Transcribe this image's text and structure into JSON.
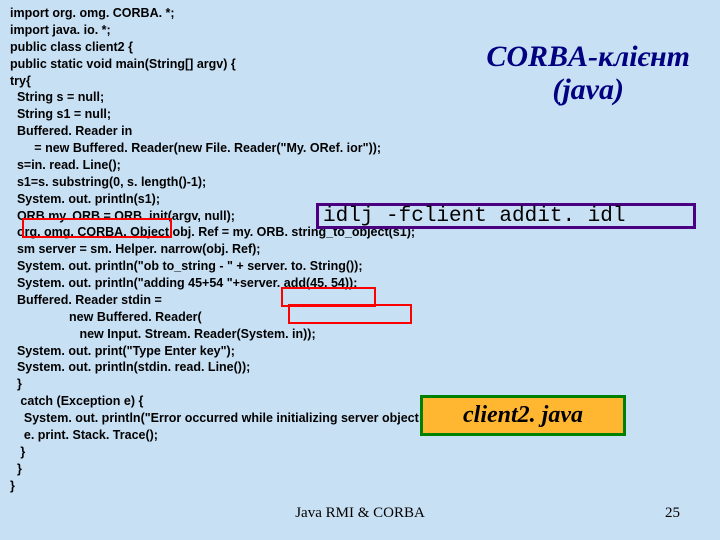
{
  "title": {
    "line1": "CORBA-клієнт",
    "line2": "(java)"
  },
  "idlj_command": "idlj -fclient addit. idl",
  "client_label": "client2. java",
  "footer": "Java RMI & CORBA",
  "page_number": "25",
  "code": "import org. omg. CORBA. *;\nimport java. io. *;\npublic class client2 {\npublic static void main(String[] argv) {\ntry{\n  String s = null;\n  String s1 = null;\n  Buffered. Reader in\n       = new Buffered. Reader(new File. Reader(\"My. ORef. ior\"));\n  s=in. read. Line();\n  s1=s. substring(0, s. length()-1);\n  System. out. println(s1);\n  ORB my. ORB = ORB. init(argv, null);\n  org. omg. CORBA. Object obj. Ref = my. ORB. string_to_object(s1);\n  sm server = sm. Helper. narrow(obj. Ref);\n  System. out. println(\"ob to_string - \" + server. to. String());\n  System. out. println(\"adding 45+54 \"+server. add(45, 54));\n  Buffered. Reader stdin =\n                 new Buffered. Reader(\n                    new Input. Stream. Reader(System. in));\n  System. out. print(\"Type Enter key\");\n  System. out. println(stdin. read. Line());\n  }\n   catch (Exception e) {\n    System. out. println(\"Error occurred while initializing server object: \");\n    e. print. Stack. Trace();\n   }\n  }\n}"
}
